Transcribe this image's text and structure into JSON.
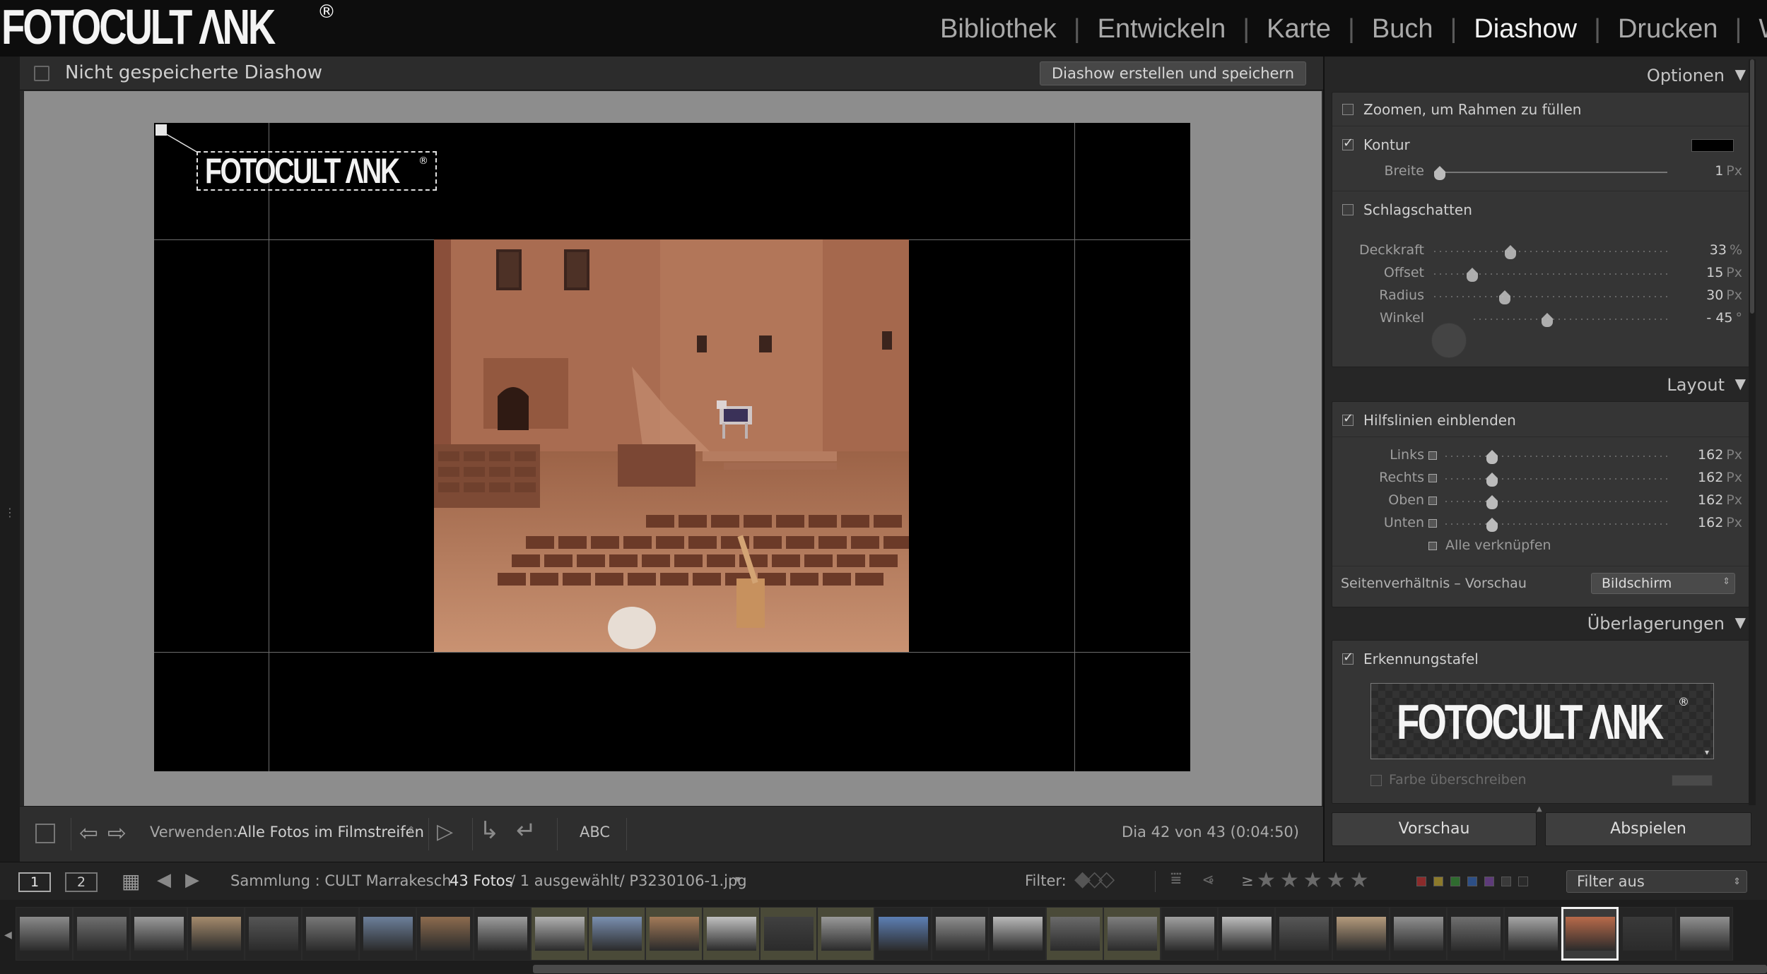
{
  "brand": {
    "logo_text": "FOTOCULT ΛΝΚ",
    "registered_mark": "®"
  },
  "modules": [
    {
      "label": "Bibliothek",
      "active": false
    },
    {
      "label": "Entwickeln",
      "active": false
    },
    {
      "label": "Karte",
      "active": false
    },
    {
      "label": "Buch",
      "active": false
    },
    {
      "label": "Diashow",
      "active": true
    },
    {
      "label": "Drucken",
      "active": false
    },
    {
      "label": "Web",
      "active": false
    }
  ],
  "center": {
    "title": "Nicht gespeicherte Diashow",
    "create_button": "Diashow erstellen und speichern"
  },
  "toolbar": {
    "use_label": "Verwenden:",
    "use_value": "Alle Fotos im Filmstreifen",
    "text_button": "ABC",
    "slide_counter": "Dia 42 von 43 (0:04:50)"
  },
  "panel": {
    "options": {
      "header": "Optionen",
      "zoom_label": "Zoomen, um Rahmen zu füllen",
      "zoom_checked": false,
      "border_label": "Kontur",
      "border_checked": true,
      "border_color": "#000000",
      "width_label": "Breite",
      "width_value": "1",
      "width_unit": "Px",
      "shadow_label": "Schlagschatten",
      "shadow_checked": false,
      "opacity_label": "Deckkraft",
      "opacity_value": "33",
      "opacity_unit": "%",
      "offset_label": "Offset",
      "offset_value": "15",
      "offset_unit": "Px",
      "radius_label": "Radius",
      "radius_value": "30",
      "radius_unit": "Px",
      "angle_label": "Winkel",
      "angle_value": "- 45",
      "angle_unit": "°"
    },
    "layout": {
      "header": "Layout",
      "guides_label": "Hilfslinien einblenden",
      "guides_checked": true,
      "left_label": "Links",
      "left_value": "162",
      "right_label": "Rechts",
      "right_value": "162",
      "top_label": "Oben",
      "top_value": "162",
      "bottom_label": "Unten",
      "bottom_value": "162",
      "unit": "Px",
      "link_all_label": "Alle verknüpfen",
      "aspect_label": "Seitenverhältnis – Vorschau",
      "aspect_value": "Bildschirm"
    },
    "overlays": {
      "header": "Überlagerungen",
      "identity_label": "Erkennungstafel",
      "identity_checked": true,
      "override_color_label": "Farbe überschreiben",
      "override_checked": false
    },
    "preview_button": "Vorschau",
    "play_button": "Abspielen"
  },
  "filmbar": {
    "monitor1": "1",
    "monitor2": "2",
    "collection_label": "Sammlung : CULT Marrakesch",
    "photo_count": "43 Fotos",
    "selection_info": "/ 1 ausgewählt/ P3230106-1.jpg",
    "filter_label": "Filter:",
    "rating_operator": "≥",
    "stars": "★★★★★",
    "filter_value": "Filter aus"
  },
  "filmstrip_count": 30,
  "colors": {
    "accent_selected": "#f0f0f0",
    "label_red": "#8b2b2b",
    "label_yellow": "#8c7a2b",
    "label_green": "#2f6b2f",
    "label_blue": "#2d4f86",
    "label_purple": "#5e3b7a"
  }
}
